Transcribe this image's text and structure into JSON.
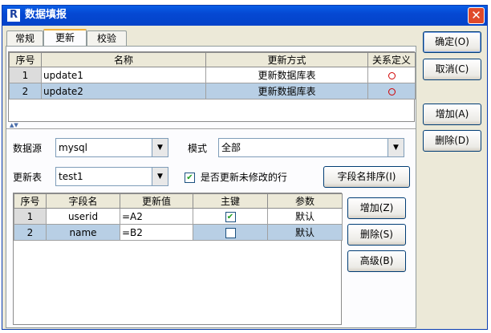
{
  "window": {
    "title": "数据填报",
    "logo": "R",
    "close_glyph": "✕"
  },
  "tabs": [
    {
      "label": "常规",
      "active": false
    },
    {
      "label": "更新",
      "active": true
    },
    {
      "label": "校验",
      "active": false
    }
  ],
  "update_table": {
    "headers": [
      "序号",
      "名称",
      "更新方式",
      "关系定义"
    ],
    "rows": [
      {
        "index": "1",
        "name": "update1",
        "method": "更新数据库表",
        "relation": "ring-icon"
      },
      {
        "index": "2",
        "name": "update2",
        "method": "更新数据库表",
        "relation": "ring-icon"
      }
    ]
  },
  "form": {
    "datasource_label": "数据源",
    "datasource_value": "mysql",
    "mode_label": "模式",
    "mode_value": "全部",
    "update_table_label": "更新表",
    "update_table_value": "test1",
    "update_unmodified_label": "是否更新未修改的行",
    "update_unmodified_checked": true,
    "sort_fields_button": "字段名排序(I)"
  },
  "field_table": {
    "headers": [
      "序号",
      "字段名",
      "更新值",
      "主键",
      "参数"
    ],
    "rows": [
      {
        "index": "1",
        "field": "userid",
        "value": "=A2",
        "key": true,
        "param": "默认"
      },
      {
        "index": "2",
        "field": "name",
        "value": "=B2",
        "key": false,
        "param": "默认"
      }
    ]
  },
  "field_buttons": {
    "add": "增加(Z)",
    "delete": "删除(S)",
    "advanced": "高级(B)"
  },
  "side_buttons": {
    "ok": "确定(O)",
    "cancel": "取消(C)",
    "add": "增加(A)",
    "delete": "删除(D)"
  },
  "icons": {
    "splitter": "▲▼",
    "check": "✔",
    "dropdown": "▼"
  },
  "colors": {
    "title_bar": "#0548d3",
    "selected_row": "#b8cfe5",
    "relation_ring": "#d00000"
  }
}
